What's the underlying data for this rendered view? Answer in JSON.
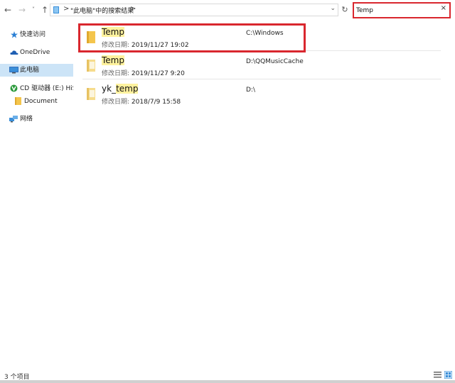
{
  "nav": {
    "back_icon": "arrow-left-icon",
    "forward_icon": "arrow-right-icon",
    "recent_icon": "chevron-down-icon",
    "up_icon": "arrow-up-icon"
  },
  "address": {
    "sep": ">",
    "location": "\"此电脑\"中的搜索结果",
    "dropdown": "⌄"
  },
  "search": {
    "value": "Temp",
    "clear": "×"
  },
  "sidebar": {
    "items": [
      {
        "label": "快速访问",
        "icon": "star-icon"
      },
      {
        "label": "OneDrive",
        "icon": "cloud-icon"
      },
      {
        "label": "此电脑",
        "icon": "computer-icon"
      },
      {
        "label": "CD 驱动器 (E:) HiSuite",
        "icon": "cd-drive-icon"
      },
      {
        "label": "Document",
        "icon": "folder-icon"
      },
      {
        "label": "网络",
        "icon": "network-icon"
      }
    ]
  },
  "results": [
    {
      "name_hl": "Temp",
      "name_rest": "",
      "name_pre": "",
      "date_label": "修改日期:",
      "date": "2019/11/27 19:02",
      "path": "C:\\Windows"
    },
    {
      "name_hl": "Temp",
      "name_rest": "",
      "name_pre": "",
      "date_label": "修改日期:",
      "date": "2019/11/27 9:20",
      "path": "D:\\QQMusicCache"
    },
    {
      "name_pre": "yk_",
      "name_hl": "temp",
      "name_rest": "",
      "date_label": "修改日期:",
      "date": "2018/7/9 15:58",
      "path": "D:\\"
    }
  ],
  "status": {
    "count": "3 个项目"
  },
  "colors": {
    "accent_red": "#d9272e",
    "selected_bg": "#cce4f7",
    "match_highlight": "#fff29e",
    "folder": "#f4c54c"
  }
}
